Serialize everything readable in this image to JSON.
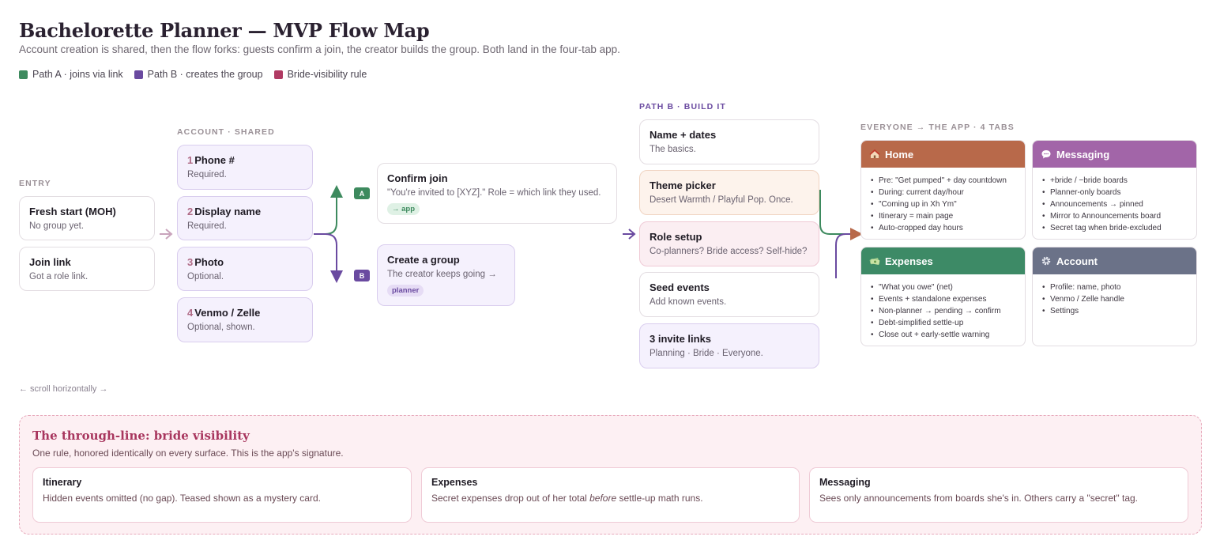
{
  "title": "Bachelorette Planner — MVP Flow Map",
  "subtitle": "Account creation is shared, then the flow forks: guests confirm a join, the creator builds the group. Both land in the four-tab app.",
  "legend": [
    {
      "label": "Path A · joins via link",
      "color": "#3d8a5e"
    },
    {
      "label": "Path B · creates the group",
      "color": "#6a4aa0"
    },
    {
      "label": "Bride-visibility rule",
      "color": "#b03a63"
    }
  ],
  "entry": {
    "label": "ENTRY",
    "cards": [
      {
        "title": "Fresh start (MOH)",
        "sub": "No group yet."
      },
      {
        "title": "Join link",
        "sub": "Got a role link."
      }
    ]
  },
  "account": {
    "label": "ACCOUNT · SHARED",
    "steps": [
      {
        "num": "1",
        "title": "Phone #",
        "sub": "Required."
      },
      {
        "num": "2",
        "title": "Display name",
        "sub": "Required."
      },
      {
        "num": "3",
        "title": "Photo",
        "sub": "Optional."
      },
      {
        "num": "4",
        "title": "Venmo / Zelle",
        "sub": "Optional, shown."
      }
    ]
  },
  "fork": {
    "a": {
      "badge": "A",
      "title": "Confirm join",
      "sub": "\"You're invited to [XYZ].\" Role = which link they used.",
      "pill": "→ app"
    },
    "b": {
      "badge": "B",
      "title": "Create a group",
      "sub": "The creator keeps going →",
      "pill": "planner"
    }
  },
  "path_b": {
    "label": "PATH B · BUILD IT",
    "steps": [
      {
        "title": "Name + dates",
        "sub": "The basics."
      },
      {
        "title": "Theme picker",
        "sub": "Desert Warmth / Playful Pop. Once."
      },
      {
        "title": "Role setup",
        "sub": "Co-planners? Bride access? Self-hide?"
      },
      {
        "title": "Seed events",
        "sub": "Add known events."
      },
      {
        "title": "3 invite links",
        "sub": "Planning · Bride · Everyone."
      }
    ]
  },
  "app": {
    "label": "EVERYONE → THE APP · 4 TABS",
    "tabs": [
      {
        "name": "Home",
        "icon": "house-icon",
        "color": "#b8694a",
        "items": [
          "Pre: \"Get pumped\" + day countdown",
          "During: current day/hour",
          "\"Coming up in Xh Ym\"",
          "Itinerary = main page",
          "Auto-cropped day hours"
        ]
      },
      {
        "name": "Messaging",
        "icon": "speech-bubble-icon",
        "color": "#a265a8",
        "items": [
          "+bride / −bride boards",
          "Planner-only boards",
          "Announcements → pinned",
          "Mirror to Announcements board",
          "Secret tag when bride-excluded"
        ]
      },
      {
        "name": "Expenses",
        "icon": "money-icon",
        "color": "#3d8a66",
        "items": [
          "\"What you owe\" (net)",
          "Events + standalone expenses",
          "Non-planner → pending → confirm",
          "Debt-simplified settle-up",
          "Close out + early-settle warning"
        ]
      },
      {
        "name": "Account",
        "icon": "gear-icon",
        "color": "#6b7288",
        "items": [
          "Profile: name, photo",
          "Venmo / Zelle handle",
          "Settings"
        ]
      }
    ]
  },
  "scroll_hint": "← scroll horizontally →",
  "bride": {
    "title": "The through-line: bride visibility",
    "sub": "One rule, honored identically on every surface. This is the app's signature.",
    "cards": [
      {
        "title": "Itinerary",
        "desc": "Hidden events omitted (no gap). Teased shown as a mystery card."
      },
      {
        "title": "Expenses",
        "desc_pre": "Secret expenses drop out of her total ",
        "desc_em": "before",
        "desc_post": " settle-up math runs."
      },
      {
        "title": "Messaging",
        "desc": "Sees only announcements from boards she's in. Others carry a \"secret\" tag."
      }
    ]
  }
}
